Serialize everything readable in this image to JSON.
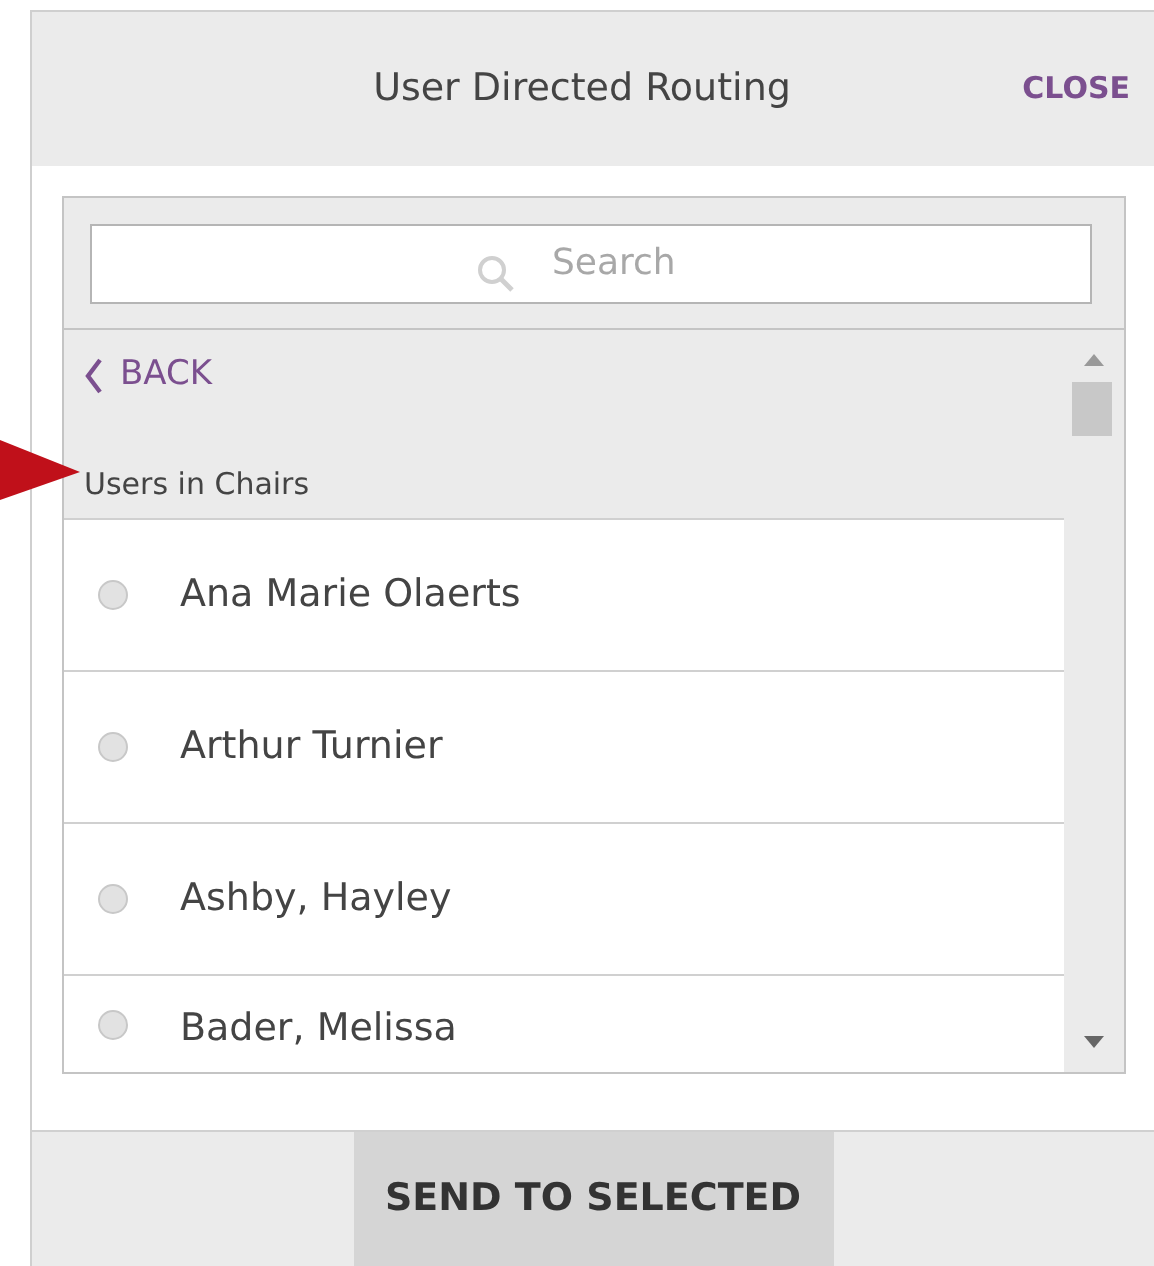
{
  "dialog": {
    "title": "User Directed Routing",
    "close_label": "CLOSE"
  },
  "search": {
    "placeholder": "Search"
  },
  "back": {
    "label": "BACK"
  },
  "group": {
    "label": "Users in Chairs"
  },
  "users": [
    {
      "name": "Ana Marie Olaerts",
      "selected": false
    },
    {
      "name": "Arthur Turnier",
      "selected": false
    },
    {
      "name": "Ashby, Hayley",
      "selected": false
    },
    {
      "name": "Bader, Melissa",
      "selected": false
    }
  ],
  "action": {
    "label": "SEND TO SELECTED"
  }
}
